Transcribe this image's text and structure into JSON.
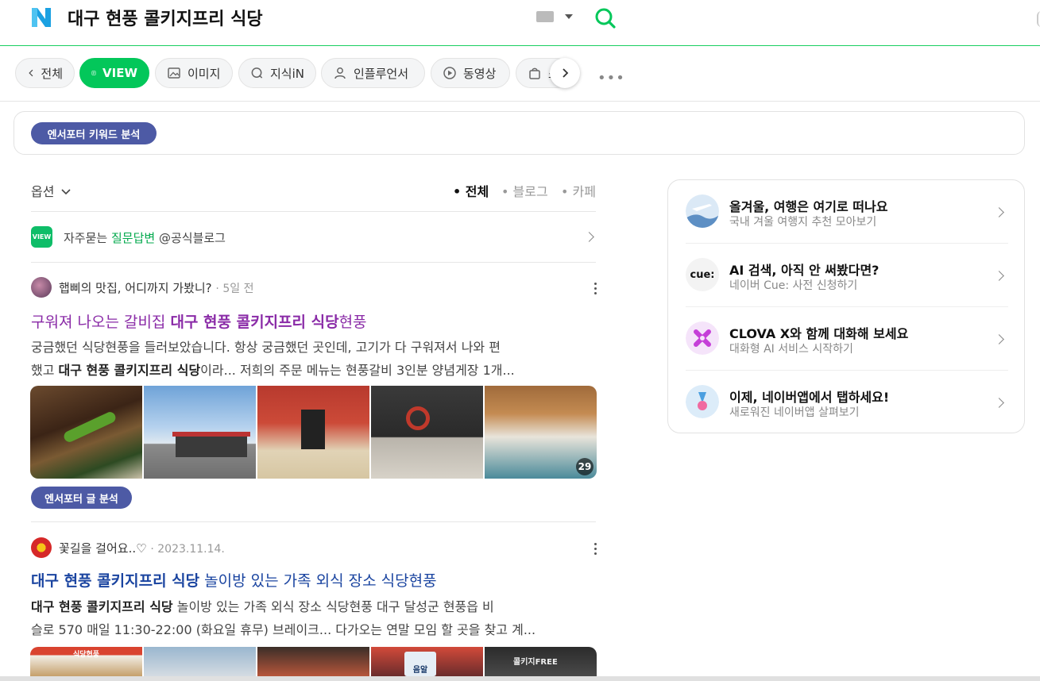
{
  "header": {
    "query": "대구 현풍 콜키지프리 식당"
  },
  "tabs": [
    {
      "label": "전체",
      "icon": "chevron-left-icon"
    },
    {
      "label": "VIEW",
      "icon": "document-icon",
      "active": true
    },
    {
      "label": "이미지",
      "icon": "image-icon"
    },
    {
      "label": "지식iN",
      "icon": "qa-icon"
    },
    {
      "label": "인플루언서",
      "icon": "person-icon"
    },
    {
      "label": "동영상",
      "icon": "play-icon"
    },
    {
      "label": "쇼",
      "icon": "shopping-bag-icon"
    }
  ],
  "keyword_analysis_label": "엔서포터 키워드 분석",
  "options": {
    "label": "옵션",
    "filters": [
      "전체",
      "블로그",
      "카페"
    ],
    "active_filter": "전체"
  },
  "faq": {
    "icon_text": "VIEW",
    "prefix": "자주묻는",
    "highlight": "질문답변",
    "suffix": "@공식블로그"
  },
  "results": [
    {
      "author": "햅삐의 맛집, 어디까지 가봤니?",
      "date": "5일 전",
      "title_pre": "구워져 나오는 갈비집 ",
      "title_bold": "대구 현풍 콜키지프리 식당",
      "title_post": "현풍",
      "snippet_line1": "궁금했던 식당현풍을 들러보았습니다. 항상 궁금했던 곳인데, 고기가 다 구워져서 나와 편",
      "snippet_line2_pre": "했고 ",
      "snippet_line2_bold": "대구 현풍 콜키지프리 식당",
      "snippet_line2_post": "이라... 저희의 주문 메뉴는 현풍갈비 3인분 양념게장 1개...",
      "image_count": "29",
      "analysis_label": "엔서포터 글 분석"
    },
    {
      "author": "꽃길을 걸어요..♡",
      "date": "2023.11.14.",
      "title_bold": "대구 현풍 콜키지프리 식당",
      "title_post": " 놀이방 있는 가족 외식 장소 식당현풍",
      "snippet_line1_bold": "대구 현풍 콜키지프리 식당",
      "snippet_line1_post": " 놀이방 있는 가족 외식 장소 식당현풍 대구 달성군 현풍읍 비",
      "snippet_line2": "슬로 570 매일 11:30-22:00 (화요일 휴무) 브레이크... 다가오는 연말 모임 할 곳을 찾고 계...",
      "thumb1_caption": "식당현풍",
      "thumb3_caption": "음알",
      "thumb5_caption": "콜키지FREE"
    }
  ],
  "side_card": [
    {
      "title": "올겨울, 여행은 여기로 떠나요",
      "subtitle": "국내 겨울 여행지 추천 모아보기",
      "icon": "airplane-icon"
    },
    {
      "title": "AI 검색, 아직 안 써봤다면?",
      "subtitle": "네이버 Cue: 사전 신청하기",
      "icon": "cue-logo-icon",
      "icon_text": "cue:"
    },
    {
      "title": "CLOVA X와 함께 대화해 보세요",
      "subtitle": "대화형 AI 서비스 시작하기",
      "icon": "clova-x-icon"
    },
    {
      "title": "이제, 네이버앱에서 탭하세요!",
      "subtitle": "새로워진 네이버앱 살펴보기",
      "icon": "medal-icon"
    }
  ]
}
